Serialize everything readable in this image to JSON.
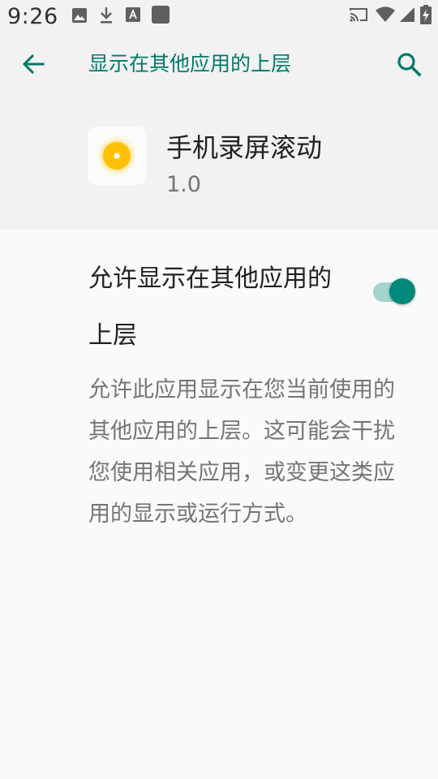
{
  "status_bar": {
    "time": "9:26",
    "icons": [
      "image-icon",
      "download-icon",
      "font-icon",
      "square-icon",
      "cast-icon",
      "wifi-icon",
      "signal-icon",
      "battery-charging-icon"
    ]
  },
  "app_bar": {
    "title": "显示在其他应用的上层",
    "back_icon": "arrow-left-icon",
    "search_icon": "search-icon",
    "accent_color": "#00796b"
  },
  "app_info": {
    "name": "手机录屏滚动",
    "version": "1.0",
    "icon": "sun-icon"
  },
  "permission": {
    "label": "允许显示在其他应用的上层",
    "enabled": true,
    "description": "允许此应用显示在您当前使用的其他应用的上层。这可能会干扰您使用相关应用，或变更这类应用的显示或运行方式。"
  }
}
